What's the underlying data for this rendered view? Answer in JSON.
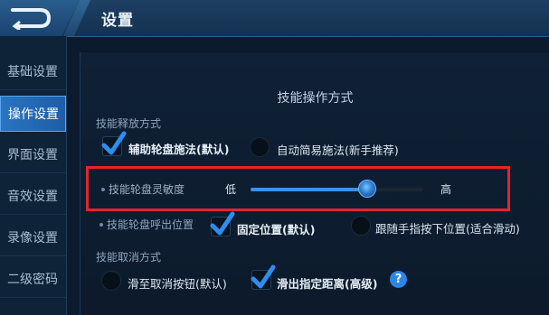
{
  "header": {
    "title": "设置"
  },
  "sidebar": {
    "items": [
      {
        "label": "基础设置"
      },
      {
        "label": "操作设置",
        "active": true
      },
      {
        "label": "界面设置"
      },
      {
        "label": "音效设置"
      },
      {
        "label": "录像设置"
      },
      {
        "label": "二级密码"
      }
    ]
  },
  "main": {
    "section_title": "技能操作方式",
    "skill_release": {
      "label": "技能释放方式",
      "options": [
        {
          "label": "辅助轮盘施法(默认)",
          "selected": true
        },
        {
          "label": "自动简易施法(新手推荐)",
          "selected": false
        }
      ]
    },
    "sensitivity": {
      "label": "技能轮盘灵敏度",
      "low_label": "低",
      "high_label": "高",
      "value": 0.67
    },
    "callout_position": {
      "label": "技能轮盘呼出位置",
      "options": [
        {
          "label": "固定位置(默认)",
          "selected": true
        },
        {
          "label": "跟随手指按下位置(适合滑动)",
          "selected": false
        }
      ]
    },
    "skill_cancel": {
      "label": "技能取消方式",
      "options": [
        {
          "label": "滑至取消按钮(默认)",
          "selected": false
        },
        {
          "label": "滑出指定距离(高级)",
          "selected": true
        }
      ]
    },
    "help_text": "?"
  },
  "colors": {
    "accent": "#2a74c2",
    "highlight": "#e0262a",
    "slider_fill": "#3f90ea"
  }
}
